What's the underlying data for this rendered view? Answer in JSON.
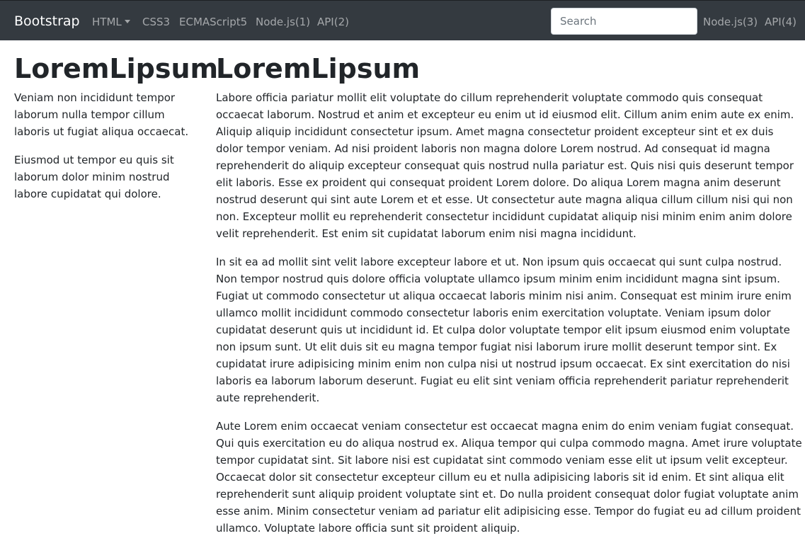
{
  "navbar": {
    "brand": "Bootstrap",
    "items": [
      {
        "label": "HTML",
        "dropdown": true
      },
      {
        "label": "CSS3"
      },
      {
        "label": "ECMAScript5"
      },
      {
        "label": "Node.js(1)"
      },
      {
        "label": "API(2)"
      }
    ],
    "search_placeholder": "Search",
    "right_items": [
      {
        "label": "Node.js(3)"
      },
      {
        "label": "API(4)"
      }
    ],
    "colors": {
      "background": "#343a40",
      "link": "rgba(255,255,255,0.55)",
      "brand": "#ffffff"
    }
  },
  "sidebar": {
    "title": "LoremLipsum",
    "paragraphs": [
      "Veniam non incididunt tempor laborum nulla tempor cillum laboris ut fugiat aliqua occaecat.",
      "Eiusmod ut tempor eu quis sit laborum dolor minim nostrud labore cupidatat qui dolore."
    ]
  },
  "main": {
    "title": "LoremLipsum",
    "paragraphs": [
      "Labore officia pariatur mollit elit voluptate do cillum reprehenderit voluptate commodo quis consequat occaecat laborum. Nostrud et anim et excepteur eu enim ut id eiusmod elit. Cillum anim enim aute ex enim. Aliquip aliquip incididunt consectetur ipsum. Amet magna consectetur proident excepteur sint et ex duis dolor tempor veniam. Ad nisi proident laboris non magna dolore Lorem nostrud. Ad consequat id magna reprehenderit do aliquip excepteur consequat quis nostrud nulla pariatur est. Quis nisi quis deserunt tempor elit laboris. Esse ex proident qui consequat proident Lorem dolore. Do aliqua Lorem magna anim deserunt nostrud deserunt qui sint aute Lorem et et esse. Ut consectetur aute magna aliqua cillum cillum nisi qui non non. Excepteur mollit eu reprehenderit consectetur incididunt cupidatat aliquip nisi minim enim anim dolore velit reprehenderit. Est enim sit cupidatat laborum enim nisi magna incididunt.",
      "In sit ea ad mollit sint velit labore excepteur labore et ut. Non ipsum quis occaecat qui sunt culpa nostrud. Non tempor nostrud quis dolore officia voluptate ullamco ipsum minim enim incididunt magna sint ipsum. Fugiat ut commodo consectetur ut aliqua occaecat laboris minim nisi anim. Consequat est minim irure enim ullamco mollit incididunt commodo consectetur laboris enim exercitation voluptate. Veniam ipsum dolor cupidatat deserunt quis ut incididunt id. Et culpa dolor voluptate tempor elit ipsum eiusmod enim voluptate non ipsum sunt. Ut elit duis sit eu magna tempor fugiat nisi laborum irure mollit deserunt tempor sint. Ex cupidatat irure adipisicing minim enim non culpa nisi ut nostrud ipsum occaecat. Ex sint exercitation do nisi laboris ea laborum laborum deserunt. Fugiat eu elit sint veniam officia reprehenderit pariatur reprehenderit aute reprehenderit.",
      "Aute Lorem enim occaecat veniam consectetur est occaecat magna enim do enim veniam fugiat consequat. Qui quis exercitation eu do aliqua nostrud ex. Aliqua tempor qui culpa commodo magna. Amet irure voluptate tempor cupidatat sint. Sit labore nisi est cupidatat sint commodo veniam esse elit ut ipsum velit excepteur. Occaecat dolor sit consectetur excepteur cillum eu et nulla adipisicing laboris sit id enim. Et sint aliqua elit reprehenderit sunt aliquip proident voluptate sint et. Do nulla proident consequat dolor fugiat voluptate anim esse anim. Minim consectetur veniam ad pariatur elit adipisicing esse. Tempor do fugiat eu ad cillum proident ullamco. Voluptate labore officia sunt sit proident aliquip."
    ]
  }
}
